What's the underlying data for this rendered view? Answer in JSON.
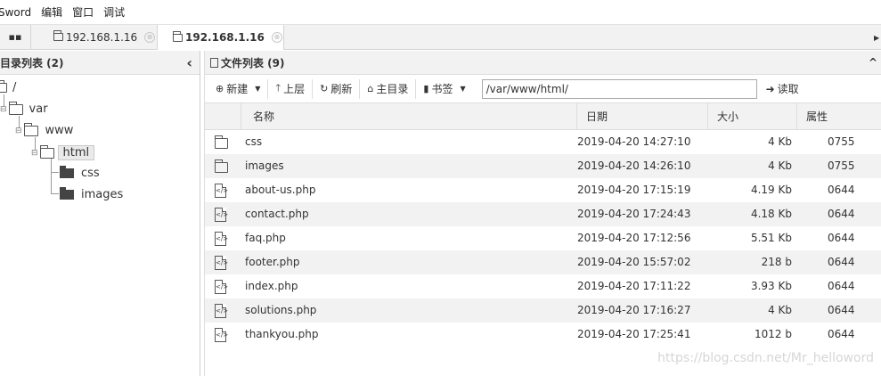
{
  "menu": [
    "Sword",
    "编辑",
    "窗口",
    "调试"
  ],
  "tabs": [
    {
      "label": "192.168.1.16",
      "close": "⊗"
    },
    {
      "label": "192.168.1.16",
      "close": "⊗"
    }
  ],
  "left_panel": {
    "title": "目录列表 (2)",
    "collapse": "‹",
    "tree": [
      {
        "label": "/"
      },
      {
        "label": "var"
      },
      {
        "label": "www"
      },
      {
        "label": "html"
      },
      {
        "label": "css"
      },
      {
        "label": "images"
      }
    ]
  },
  "right_panel": {
    "title": "文件列表 (9)",
    "collapse": "^",
    "toolbar": {
      "new_label": "新建",
      "up_label": "上层",
      "refresh_label": "刷新",
      "home_label": "主目录",
      "bookmark_label": "书签",
      "path_value": "/var/www/html/",
      "read_label": "读取"
    },
    "columns": [
      "名称",
      "日期",
      "大小",
      "属性"
    ],
    "files": [
      {
        "name": "css",
        "date": "2019-04-20 14:27:10",
        "size": "4 Kb",
        "perm": "0755",
        "type": "folder"
      },
      {
        "name": "images",
        "date": "2019-04-20 14:26:10",
        "size": "4 Kb",
        "perm": "0755",
        "type": "folder"
      },
      {
        "name": "about-us.php",
        "date": "2019-04-20 17:15:19",
        "size": "4.19 Kb",
        "perm": "0644",
        "type": "file"
      },
      {
        "name": "contact.php",
        "date": "2019-04-20 17:24:43",
        "size": "4.18 Kb",
        "perm": "0644",
        "type": "file"
      },
      {
        "name": "faq.php",
        "date": "2019-04-20 17:12:56",
        "size": "5.51 Kb",
        "perm": "0644",
        "type": "file"
      },
      {
        "name": "footer.php",
        "date": "2019-04-20 15:57:02",
        "size": "218 b",
        "perm": "0644",
        "type": "file"
      },
      {
        "name": "index.php",
        "date": "2019-04-20 17:11:22",
        "size": "3.93 Kb",
        "perm": "0644",
        "type": "file"
      },
      {
        "name": "solutions.php",
        "date": "2019-04-20 17:16:27",
        "size": "4 Kb",
        "perm": "0644",
        "type": "file"
      },
      {
        "name": "thankyou.php",
        "date": "2019-04-20 17:25:41",
        "size": "1012 b",
        "perm": "0644",
        "type": "file"
      }
    ]
  },
  "watermark": "https://blog.csdn.net/Mr_helloword"
}
